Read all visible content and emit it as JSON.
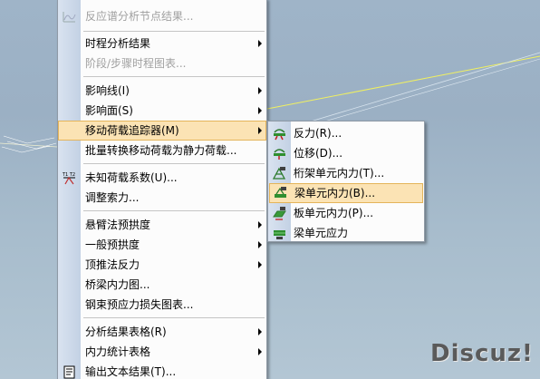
{
  "main_menu": {
    "items": [
      {
        "label": "反应谱分析节点结果...",
        "disabled": true,
        "submenu": false
      },
      {
        "label": "时程分析结果",
        "disabled": false,
        "submenu": true
      },
      {
        "label": "阶段/步骤时程图表...",
        "disabled": true,
        "submenu": false
      },
      {
        "label": "影响线(I)",
        "disabled": false,
        "submenu": true
      },
      {
        "label": "影响面(S)",
        "disabled": false,
        "submenu": true
      },
      {
        "label": "移动荷载追踪器(M)",
        "disabled": false,
        "submenu": true,
        "highlighted": true
      },
      {
        "label": "批量转换移动荷载为静力荷载...",
        "disabled": false,
        "submenu": false
      },
      {
        "label": "未知荷载系数(U)...",
        "disabled": false,
        "submenu": false
      },
      {
        "label": "调整索力...",
        "disabled": false,
        "submenu": false
      },
      {
        "label": "悬臂法预拱度",
        "disabled": false,
        "submenu": true
      },
      {
        "label": "一般预拱度",
        "disabled": false,
        "submenu": true
      },
      {
        "label": "顶推法反力",
        "disabled": false,
        "submenu": true
      },
      {
        "label": "桥梁内力图...",
        "disabled": false,
        "submenu": false
      },
      {
        "label": "钢束预应力损失图表...",
        "disabled": false,
        "submenu": false
      },
      {
        "label": "分析结果表格(R)",
        "disabled": false,
        "submenu": true
      },
      {
        "label": "内力统计表格",
        "disabled": false,
        "submenu": true
      },
      {
        "label": "输出文本结果(T)...",
        "disabled": false,
        "submenu": false
      }
    ]
  },
  "sub_menu": {
    "items": [
      {
        "label": "反力(R)..."
      },
      {
        "label": "位移(D)..."
      },
      {
        "label": "桁架单元内力(T)..."
      },
      {
        "label": "梁单元内力(B)...",
        "highlighted": true
      },
      {
        "label": "板单元内力(P)..."
      },
      {
        "label": "梁单元应力"
      }
    ]
  },
  "watermark": {
    "text": "Discuz!"
  },
  "colors": {
    "highlight": "#fbe3b4",
    "highlight_border": "#e4b45a",
    "gutter": "#c9d6e8",
    "viewport": "#a3b8ca"
  }
}
